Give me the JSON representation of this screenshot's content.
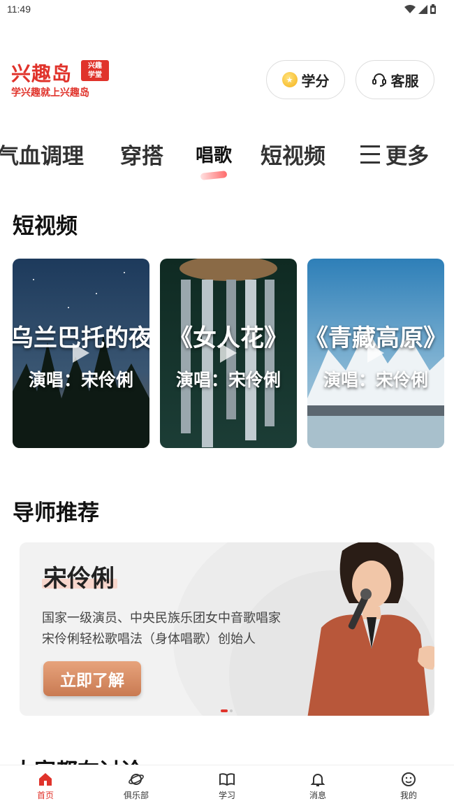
{
  "status_bar": {
    "time": "11:49"
  },
  "header": {
    "logo": {
      "brand": "兴趣岛",
      "badge_line1": "兴趣",
      "badge_line2": "学堂",
      "slogan": "学兴趣就上兴趣岛"
    },
    "credits_label": "学分",
    "service_label": "客服"
  },
  "tabs": [
    {
      "label": "气血调理",
      "active": false
    },
    {
      "label": "穿搭",
      "active": false
    },
    {
      "label": "唱歌",
      "active": true
    },
    {
      "label": "短视频",
      "active": false
    }
  ],
  "more_label": "更多",
  "short_videos": {
    "title": "短视频",
    "items": [
      {
        "title": "乌兰巴托的夜",
        "singer": "演唱：宋伶俐"
      },
      {
        "title": "《女人花》",
        "singer": "演唱：宋伶俐"
      },
      {
        "title": "《青藏高原》",
        "singer": "演唱：宋伶俐"
      }
    ]
  },
  "mentor": {
    "section_title": "导师推荐",
    "name": "宋伶俐",
    "desc_line1": "国家一级演员、中央民族乐团女中音歌唱家",
    "desc_line2": "宋伶俐轻松歌唱法（身体唱歌）创始人",
    "button": "立即了解"
  },
  "next_section_title": "大家都在讨论",
  "bottom_nav": [
    {
      "label": "首页",
      "icon": "home-icon",
      "active": true
    },
    {
      "label": "俱乐部",
      "icon": "planet-icon",
      "active": false
    },
    {
      "label": "学习",
      "icon": "book-icon",
      "active": false
    },
    {
      "label": "消息",
      "icon": "bell-icon",
      "active": false
    },
    {
      "label": "我的",
      "icon": "smile-icon",
      "active": false
    }
  ],
  "colors": {
    "brand": "#e0332b",
    "button_gradient_top": "#e7a37c",
    "button_gradient_bottom": "#c97a52"
  }
}
